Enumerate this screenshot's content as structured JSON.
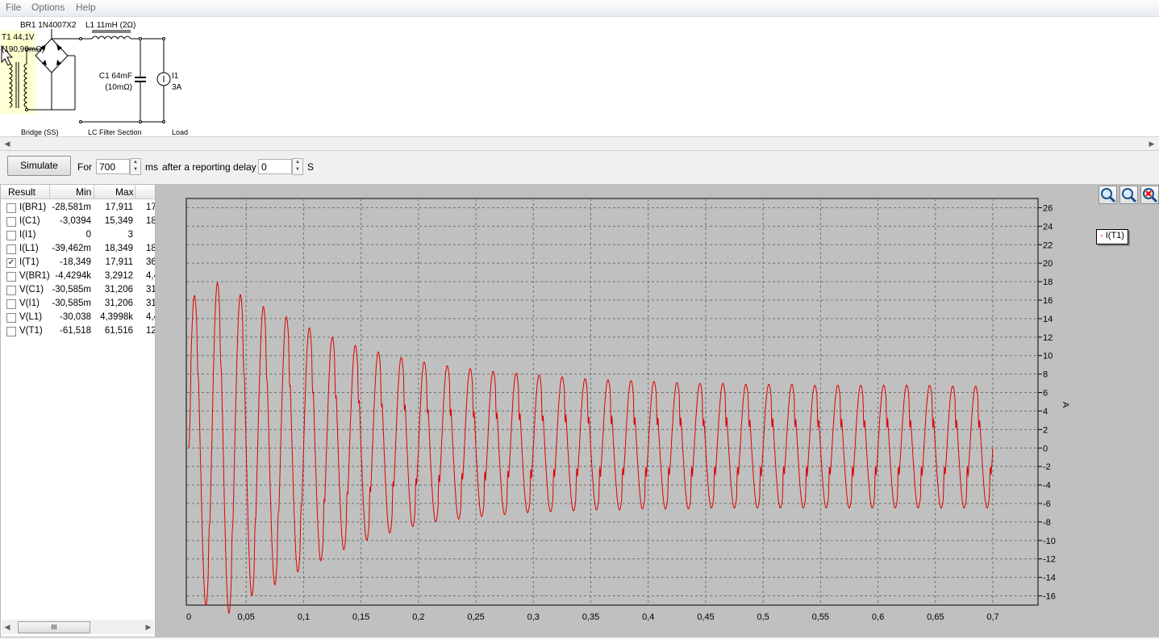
{
  "menu": [
    "File",
    "Options",
    "Help"
  ],
  "schematic": {
    "t1_label": "T1 44,1V",
    "t1_sub": "(190,90mΩ)",
    "br1_label": "BR1 1N4007X2",
    "l1_label": "L1 11mH (2Ω)",
    "c1_label": "C1 64mF",
    "c1_sub": "(10mΩ)",
    "i1_label": "I1",
    "i1_sub": "3A",
    "section_bridge": "Bridge (SS)",
    "section_lc": "LC Filter Section",
    "section_load": "Load"
  },
  "toolbar": {
    "simulate_label": "Simulate",
    "for_label": "For",
    "duration_value": "700",
    "ms_label": "ms",
    "delay_label": "after a reporting delay of",
    "delay_value": "0",
    "s_label": "S"
  },
  "results": {
    "headers": [
      "Result",
      "Min",
      "Max"
    ],
    "rows": [
      {
        "name": "I(BR1)",
        "min": "-28,581m",
        "max": "17,911",
        "extra": "17",
        "checked": false
      },
      {
        "name": "I(C1)",
        "min": "-3,0394",
        "max": "15,349",
        "extra": "18",
        "checked": false
      },
      {
        "name": "I(I1)",
        "min": "0",
        "max": "3",
        "extra": "",
        "checked": false
      },
      {
        "name": "I(L1)",
        "min": "-39,462m",
        "max": "18,349",
        "extra": "18",
        "checked": false
      },
      {
        "name": "I(T1)",
        "min": "-18,349",
        "max": "17,911",
        "extra": "36",
        "checked": true
      },
      {
        "name": "V(BR1)",
        "min": "-4,4294k",
        "max": "3,2912",
        "extra": "4,4",
        "checked": false
      },
      {
        "name": "V(C1)",
        "min": "-30,585m",
        "max": "31,206",
        "extra": "31",
        "checked": false
      },
      {
        "name": "V(I1)",
        "min": "-30,585m",
        "max": "31,206",
        "extra": "31",
        "checked": false
      },
      {
        "name": "V(L1)",
        "min": "-30,038",
        "max": "4,3998k",
        "extra": "4,4",
        "checked": false
      },
      {
        "name": "V(T1)",
        "min": "-61,518",
        "max": "61,516",
        "extra": "12",
        "checked": false
      }
    ],
    "scroll_thumb": "III"
  },
  "zoom_icons": [
    "zoom-in-icon",
    "zoom-out-icon",
    "zoom-reset-icon"
  ],
  "chart_data": {
    "type": "line",
    "title": "",
    "xlabel": "",
    "ylabel": "A",
    "xlim": [
      0,
      0.7
    ],
    "ylim": [
      -17,
      27
    ],
    "x_ticks": [
      "0",
      "0,05",
      "0,1",
      "0,15",
      "0,2",
      "0,25",
      "0,3",
      "0,35",
      "0,4",
      "0,45",
      "0,5",
      "0,55",
      "0,6",
      "0,65",
      "0,7"
    ],
    "y_ticks": [
      "26",
      "24",
      "22",
      "20",
      "18",
      "16",
      "14",
      "12",
      "10",
      "8",
      "6",
      "4",
      "2",
      "0",
      "-2",
      "-4",
      "-6",
      "-8",
      "-10",
      "-12",
      "-14",
      "-16"
    ],
    "grid": true,
    "legend": "top-right",
    "color": "#e00000",
    "series": [
      {
        "name": "I(T1)",
        "signal_frequency_hz": 50,
        "positive_peaks": [
          16.5,
          17.9,
          16.6,
          15.3,
          14.2,
          13.0,
          12.0,
          11.1,
          10.4,
          9.8,
          9.3,
          8.9,
          8.6,
          8.3,
          8.1,
          7.9,
          7.7,
          7.5,
          7.4,
          7.3,
          7.2,
          7.1,
          7.0,
          7.0,
          6.9,
          6.9,
          6.9,
          6.8,
          6.8,
          6.8,
          6.8,
          6.8,
          6.8,
          6.7,
          6.7
        ],
        "negative_peaks": [
          -17.0,
          -17.9,
          -16.0,
          -14.8,
          -13.4,
          -12.2,
          -11.0,
          -10.0,
          -9.2,
          -8.5,
          -8.0,
          -7.7,
          -7.4,
          -7.2,
          -7.0,
          -6.9,
          -6.8,
          -6.7,
          -6.7,
          -6.6,
          -6.6,
          -6.6,
          -6.5,
          -6.5,
          -6.5,
          -6.5,
          -6.5,
          -6.5,
          -6.5,
          -6.5,
          -6.5,
          -6.5,
          -6.5,
          -6.5,
          -6.5
        ]
      }
    ]
  }
}
